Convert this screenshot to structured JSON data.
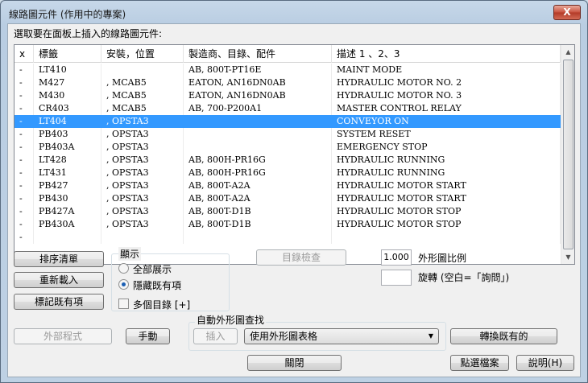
{
  "window": {
    "title": "線路圖元件 (作用中的專案)",
    "close_glyph": "X"
  },
  "prompt": "選取要在面板上插入的線路圖元件:",
  "table": {
    "headers": [
      "x",
      "標籤",
      "安裝，位置",
      "製造商、目錄、配件",
      "描述 1 、2、3"
    ],
    "rows": [
      [
        "-",
        "LT410",
        "",
        "AB, 800T-PT16E",
        "MAINT MODE"
      ],
      [
        "-",
        "M427",
        ", MCAB5",
        "EATON, AN16DN0AB",
        "HYDRAULIC MOTOR NO. 2"
      ],
      [
        "-",
        "M430",
        ", MCAB5",
        "EATON, AN16DN0AB",
        "HYDRAULIC MOTOR NO. 3"
      ],
      [
        "-",
        "CR403",
        ", MCAB5",
        "AB, 700-P200A1",
        "MASTER CONTROL RELAY"
      ],
      [
        "-",
        "LT404",
        ", OPSTA3",
        "",
        "CONVEYOR ON"
      ],
      [
        "-",
        "PB403",
        ", OPSTA3",
        "",
        "SYSTEM RESET"
      ],
      [
        "-",
        "PB403A",
        ", OPSTA3",
        "",
        "EMERGENCY STOP"
      ],
      [
        "-",
        "LT428",
        ", OPSTA3",
        "AB, 800H-PR16G",
        "HYDRAULIC RUNNING"
      ],
      [
        "-",
        "LT431",
        ", OPSTA3",
        "AB, 800H-PR16G",
        "HYDRAULIC RUNNING"
      ],
      [
        "-",
        "PB427",
        ", OPSTA3",
        "AB, 800T-A2A",
        "HYDRAULIC MOTOR START"
      ],
      [
        "-",
        "PB430",
        ", OPSTA3",
        "AB, 800T-A2A",
        "HYDRAULIC MOTOR START"
      ],
      [
        "-",
        "PB427A",
        ", OPSTA3",
        "AB, 800T-D1B",
        "HYDRAULIC MOTOR STOP"
      ],
      [
        "-",
        "PB430A",
        ", OPSTA3",
        "AB, 800T-D1B",
        "HYDRAULIC MOTOR STOP"
      ],
      [
        "-",
        "",
        "",
        "",
        ""
      ]
    ],
    "selected_row": 4
  },
  "buttons": {
    "sort_list": "排序清單",
    "reload": "重新載入",
    "mark_existing": "標記既有項",
    "catalog_check": "目錄檢查",
    "external_program": "外部程式",
    "manual": "手動",
    "insert": "插入",
    "convert_existing": "轉換既有的",
    "close": "關閉",
    "pick_file": "點選檔案",
    "help": "說明(H)"
  },
  "display": {
    "label": "顯示",
    "show_all": "全部展示",
    "hide_existing": "隱藏既有項",
    "multi_catalog": "多個目錄 [+]"
  },
  "scale": {
    "value": "1.000",
    "label": "外形圖比例"
  },
  "rotate": {
    "value": "",
    "label": "旋轉 (空白=「詢問」)"
  },
  "auto_lookup": {
    "label": "自動外形圖查找",
    "selected": "使用外形圖表格"
  },
  "colors": {
    "selection": "#3399ff"
  }
}
